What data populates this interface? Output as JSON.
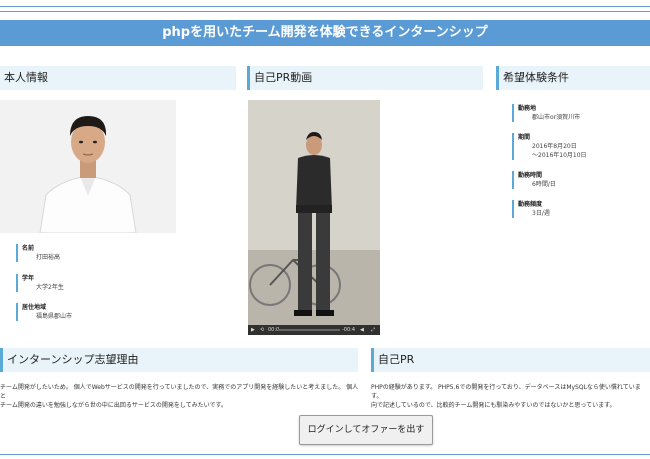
{
  "banner": {
    "title": "phpを用いたチーム開発を体験できるインターンシップ"
  },
  "sections": {
    "profile": "本人情報",
    "video": "自己PR動画",
    "conditions": "希望体験条件",
    "reason": "インターンシップ志望理由",
    "self_pr": "自己PR"
  },
  "profile": [
    {
      "label": "名前",
      "value": "打田裕高"
    },
    {
      "label": "学年",
      "value": "大学2年生"
    },
    {
      "label": "居住地域",
      "value": "福島県郡山市"
    }
  ],
  "conditions": [
    {
      "label": "勤務地",
      "values": [
        "郡山市or須賀川市"
      ]
    },
    {
      "label": "期間",
      "values": [
        "2016年8月20日",
        "～2016年10月10日"
      ]
    },
    {
      "label": "勤務時間",
      "values": [
        "6時間/日"
      ]
    },
    {
      "label": "勤務頻度",
      "values": [
        "3日/週"
      ]
    }
  ],
  "video": {
    "current_time": "00:0",
    "remaining_time": "-00:4"
  },
  "reason_text": [
    "チーム開発がしたいため。 個人でWebサービスの開発を行っていましたので、実務でのアプリ開発を経験したいと考えました。 個人と",
    "チーム開発の違いを勉強しながら世の中に出回るサービスの開発をしてみたいです。"
  ],
  "self_pr_text": [
    "PHPの経験があります。 PHP5.6での開発を行っており、データベースはMySQLなら使い慣れています。",
    "向で記述しているので、比較的チーム開発にも馴染みやすいのではないかと思っています。"
  ],
  "offer_button": "ログインしてオファーを出す"
}
